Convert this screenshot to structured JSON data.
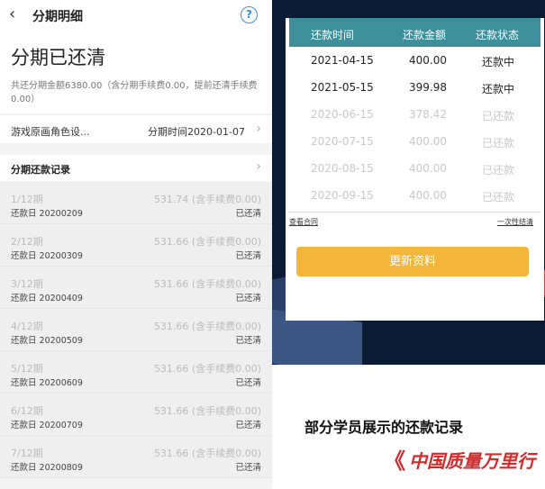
{
  "left": {
    "nav": {
      "title": "分期明细",
      "back_icon": "‹",
      "help_icon": "?"
    },
    "summary": {
      "status": "分期已还清",
      "text": "共还分期金额6380.00（含分期手续费0.00，提前还清手续费0.00）"
    },
    "info": {
      "left": "游戏原画角色设...",
      "right": "分期时间2020-01-07"
    },
    "record_title": "分期还款记录",
    "records": [
      {
        "period": "1/12期",
        "amount": "531.74 (含手续费0.00)",
        "date": "还款日 20200209",
        "status": "已还清"
      },
      {
        "period": "2/12期",
        "amount": "531.66 (含手续费0.00)",
        "date": "还款日 20200309",
        "status": "已还清"
      },
      {
        "period": "3/12期",
        "amount": "531.66 (含手续费0.00)",
        "date": "还款日 20200409",
        "status": "已还清"
      },
      {
        "period": "4/12期",
        "amount": "531.66 (含手续费0.00)",
        "date": "还款日 20200509",
        "status": "已还清"
      },
      {
        "period": "5/12期",
        "amount": "531.66 (含手续费0.00)",
        "date": "还款日 20200609",
        "status": "已还清"
      },
      {
        "period": "6/12期",
        "amount": "531.66 (含手续费0.00)",
        "date": "还款日 20200709",
        "status": "已还清"
      },
      {
        "period": "7/12期",
        "amount": "531.66 (含手续费0.00)",
        "date": "还款日 20200809",
        "status": "已还清"
      }
    ]
  },
  "right": {
    "table": {
      "headers": [
        "还款时间",
        "还款金额",
        "还款状态"
      ],
      "rows": [
        {
          "date": "2021-04-15",
          "amount": "400.00",
          "status": "还款中"
        },
        {
          "date": "2021-05-15",
          "amount": "399.98",
          "status": "还款中"
        },
        {
          "date": "2020-06-15",
          "amount": "378.42",
          "status": "已还款"
        },
        {
          "date": "2020-07-15",
          "amount": "400.00",
          "status": "已还款"
        },
        {
          "date": "2020-08-15",
          "amount": "400.00",
          "status": "已还款"
        },
        {
          "date": "2020-09-15",
          "amount": "400.00",
          "status": "已还款"
        }
      ]
    },
    "view_contract": "查看合同",
    "settle_link": "一次性结清",
    "update_button": "更新资料"
  },
  "caption": "部分学员展示的还款记录",
  "logo": {
    "mark": "《",
    "text": "中国质量万里行"
  },
  "colors": {
    "table_header": "#3d8f9b",
    "button": "#f3b63b",
    "help": "#3a8ee6",
    "logo": "#d32a2a"
  }
}
